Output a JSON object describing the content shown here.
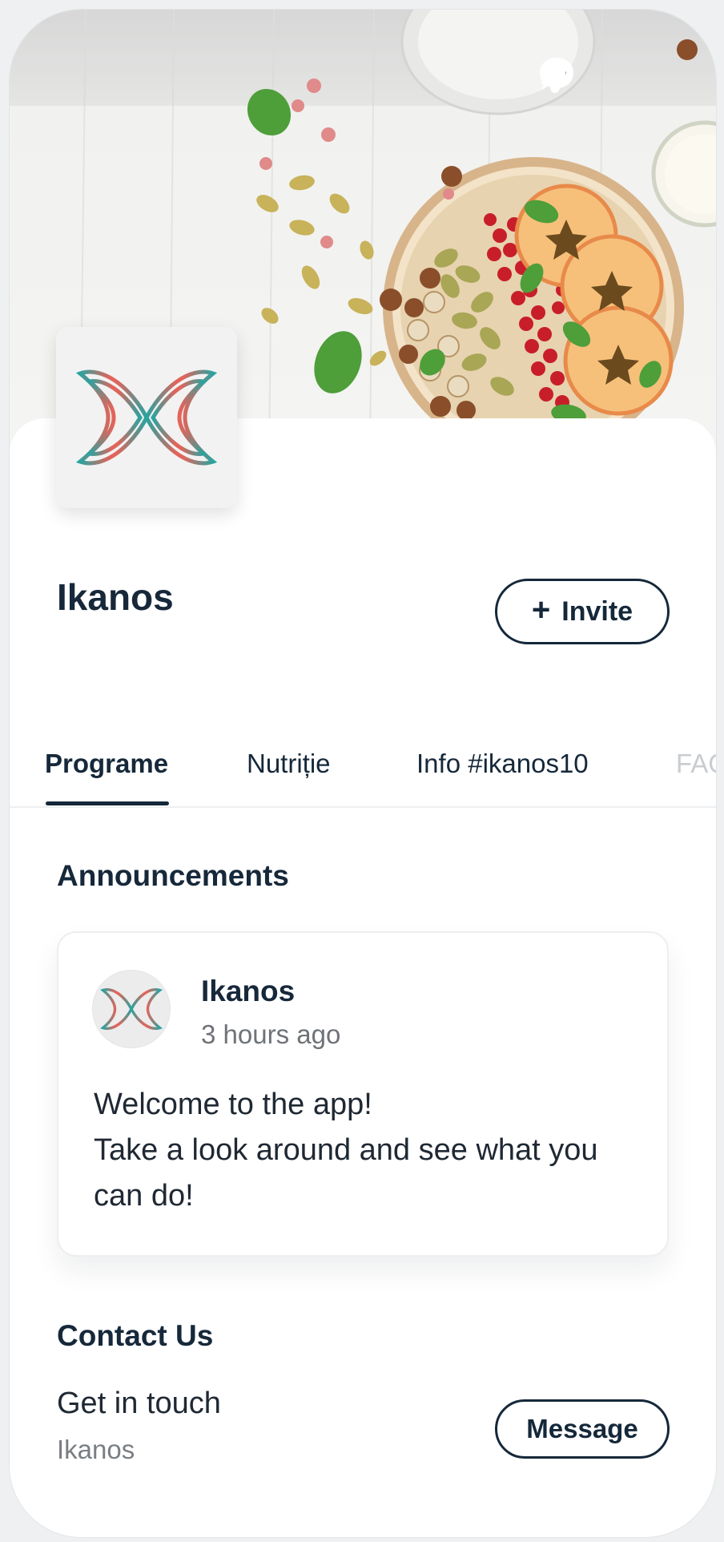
{
  "header": {
    "icons": [
      "chat-bubble-icon",
      "bell-icon"
    ]
  },
  "group": {
    "name": "Ikanos",
    "invite_label": "Invite",
    "invite_icon": "plus-icon"
  },
  "tabs": [
    {
      "label": "Programe",
      "active": true
    },
    {
      "label": "Nutriție",
      "active": false
    },
    {
      "label": "Info #ikanos10",
      "active": false
    },
    {
      "label": "FAQ",
      "active": false
    }
  ],
  "announcements": {
    "title": "Announcements",
    "post": {
      "author": "Ikanos",
      "time": "3 hours ago",
      "lines": [
        "Welcome to the app!",
        "Take a look around and see what you",
        "can do!"
      ]
    }
  },
  "contact": {
    "title": "Contact Us",
    "line1": "Get in touch",
    "line2": "Ikanos",
    "button_label": "Message"
  },
  "colors": {
    "primary": "#15283a",
    "logo_teal": "#2aa3a0",
    "logo_coral": "#e2645a",
    "background": "#ffffff"
  }
}
